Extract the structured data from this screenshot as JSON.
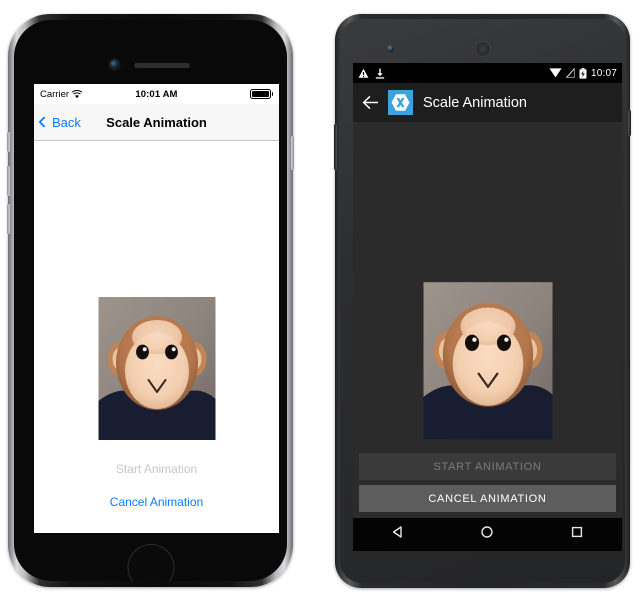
{
  "ios": {
    "device_name": "iPhone",
    "status_bar": {
      "carrier": "Carrier",
      "wifi_icon": "wifi-icon",
      "time": "10:01 AM",
      "battery_icon": "battery-full-icon"
    },
    "nav_bar": {
      "back_label": "Back",
      "back_icon": "chevron-left-icon",
      "title": "Scale Animation"
    },
    "content": {
      "image_name": "monkey-photo",
      "image_alt": "Plush monkey toy"
    },
    "actions": {
      "start_label": "Start Animation",
      "start_enabled": false,
      "cancel_label": "Cancel Animation",
      "cancel_enabled": true
    },
    "home_button": "home-button"
  },
  "android": {
    "device_name": "Android phone",
    "status_bar": {
      "warning_icon": "warning-triangle-icon",
      "download_icon": "download-icon",
      "wifi_icon": "wifi-icon",
      "signal_icon": "no-signal-icon",
      "battery_icon": "battery-charging-icon",
      "time": "10:07"
    },
    "toolbar": {
      "back_icon": "arrow-left-icon",
      "logo_icon": "xamarin-logo-icon",
      "title": "Scale Animation"
    },
    "content": {
      "image_name": "monkey-photo",
      "image_alt": "Plush monkey toy"
    },
    "actions": {
      "start_label": "START ANIMATION",
      "start_enabled": false,
      "cancel_label": "CANCEL ANIMATION",
      "cancel_enabled": true
    },
    "nav_bar": {
      "back_icon": "nav-back-triangle-icon",
      "home_icon": "nav-home-circle-icon",
      "recents_icon": "nav-recents-square-icon"
    }
  },
  "colors": {
    "ios_accent": "#0a7cff",
    "ios_disabled": "#c5c7ca",
    "ios_navbar_bg": "#f7f7f8",
    "android_bg": "#2b2b2b",
    "android_toolbar_bg": "#1e1e1e",
    "android_logo_blue": "#3ba3e0",
    "android_btn_enabled_bg": "#5d5d5d",
    "android_btn_disabled_bg": "#3a3a3a",
    "android_btn_disabled_text": "#7b7b7b"
  }
}
